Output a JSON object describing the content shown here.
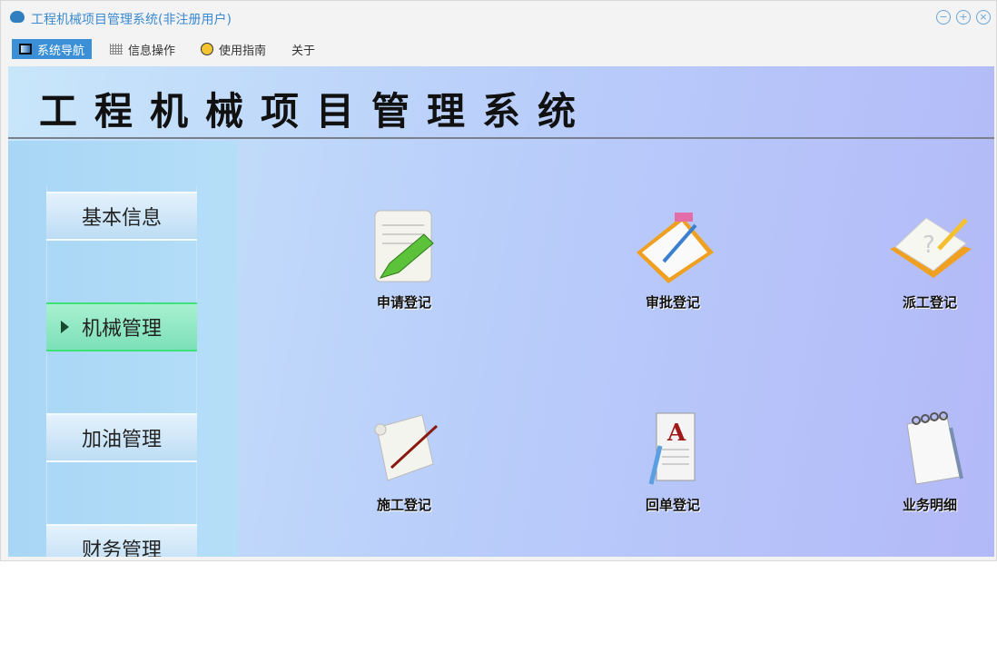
{
  "window": {
    "title": "工程机械项目管理系统(非注册用户)"
  },
  "menu": [
    {
      "label": "系统导航",
      "active": true
    },
    {
      "label": "信息操作"
    },
    {
      "label": "使用指南"
    },
    {
      "label": "关于"
    }
  ],
  "banner": {
    "title": "工程机械项目管理系统"
  },
  "sidebar": {
    "items": [
      {
        "label": "基本信息"
      },
      {
        "label": "机械管理",
        "selected": true
      },
      {
        "label": "加油管理"
      },
      {
        "label": "财务管理"
      }
    ]
  },
  "tiles": [
    {
      "label": "申请登记"
    },
    {
      "label": "审批登记"
    },
    {
      "label": "派工登记"
    },
    {
      "label": "施工登记"
    },
    {
      "label": "回单登记"
    },
    {
      "label": "业务明细"
    }
  ],
  "colors": {
    "accent": "#3a8fd6",
    "selected": "#7ce0b8"
  }
}
